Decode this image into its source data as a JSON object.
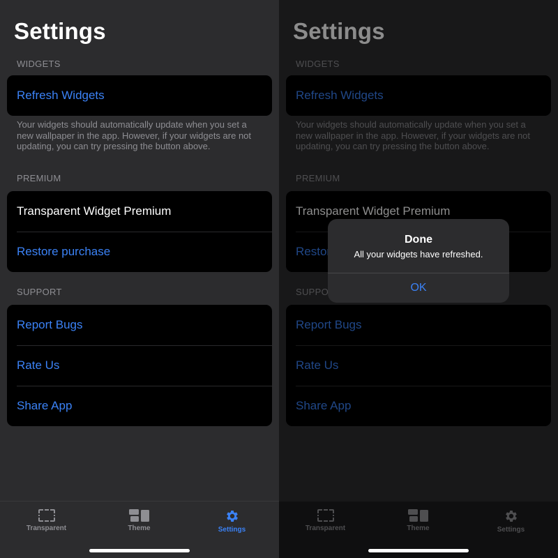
{
  "colors": {
    "accent": "#3b82f6",
    "background": "#2c2c2e",
    "cell": "#000000",
    "secondary_text": "#8e8e93"
  },
  "screens": [
    {
      "title": "Settings",
      "sections": {
        "widgets": {
          "header": "WIDGETS",
          "items": [
            "Refresh Widgets"
          ],
          "footer": "Your widgets should automatically update when you set a new wallpaper in the app. However, if your widgets are not updating, you can try pressing the button above."
        },
        "premium": {
          "header": "PREMIUM",
          "items": [
            "Transparent Widget Premium",
            "Restore purchase"
          ]
        },
        "support": {
          "header": "SUPPORT",
          "items": [
            "Report Bugs",
            "Rate Us",
            "Share App"
          ]
        }
      },
      "tabbar": {
        "tabs": [
          {
            "label": "Transparent",
            "icon": "transparent-frame-icon"
          },
          {
            "label": "Theme",
            "icon": "theme-grid-icon"
          },
          {
            "label": "Settings",
            "icon": "gear-icon",
            "active": true
          }
        ]
      }
    },
    {
      "title": "Settings",
      "sections": {
        "widgets": {
          "header": "WIDGETS",
          "items": [
            "Refresh Widgets"
          ],
          "footer": "Your widgets should automatically update when you set a new wallpaper in the app. However, if your widgets are not updating, you can try pressing the button above."
        },
        "premium": {
          "header": "PREMIUM",
          "items": [
            "Transparent Widget Premium",
            "Restore purchase"
          ]
        },
        "support": {
          "header": "SUPPORT",
          "items": [
            "Report Bugs",
            "Rate Us",
            "Share App"
          ]
        }
      },
      "tabbar": {
        "tabs": [
          {
            "label": "Transparent",
            "icon": "transparent-frame-icon"
          },
          {
            "label": "Theme",
            "icon": "theme-grid-icon"
          },
          {
            "label": "Settings",
            "icon": "gear-icon"
          }
        ]
      },
      "alert": {
        "title": "Done",
        "message": "All your widgets have refreshed.",
        "button": "OK"
      }
    }
  ]
}
